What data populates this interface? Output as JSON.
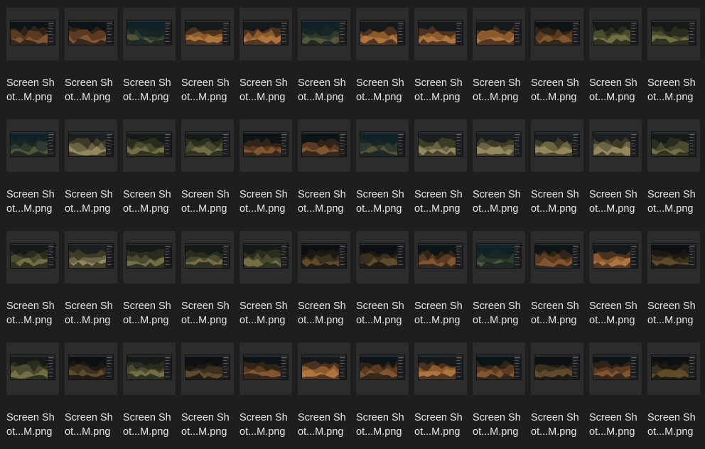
{
  "colors": {
    "background": "#1e1e1e",
    "thumbnail_frame": "#2c2c2c",
    "label_text": "#e6e6e6"
  },
  "files": [
    {
      "name_line1": "Screen Sh",
      "name_line2": "ot...M.png",
      "tone": "dark-orange"
    },
    {
      "name_line1": "Screen Sh",
      "name_line2": "ot...M.png",
      "tone": "dark-orange"
    },
    {
      "name_line1": "Screen Sh",
      "name_line2": "ot...M.png",
      "tone": "teal"
    },
    {
      "name_line1": "Screen Sh",
      "name_line2": "ot...M.png",
      "tone": "orange"
    },
    {
      "name_line1": "Screen Sh",
      "name_line2": "ot...M.png",
      "tone": "orange"
    },
    {
      "name_line1": "Screen Sh",
      "name_line2": "ot...M.png",
      "tone": "teal"
    },
    {
      "name_line1": "Screen Sh",
      "name_line2": "ot...M.png",
      "tone": "orange"
    },
    {
      "name_line1": "Screen Sh",
      "name_line2": "ot...M.png",
      "tone": "orange"
    },
    {
      "name_line1": "Screen Sh",
      "name_line2": "ot...M.png",
      "tone": "orange"
    },
    {
      "name_line1": "Screen Sh",
      "name_line2": "ot...M.png",
      "tone": "dark-orange"
    },
    {
      "name_line1": "Screen Sh",
      "name_line2": "ot...M.png",
      "tone": "olive"
    },
    {
      "name_line1": "Screen Sh",
      "name_line2": "ot...M.png",
      "tone": "olive"
    },
    {
      "name_line1": "Screen Sh",
      "name_line2": "ot...M.png",
      "tone": "teal"
    },
    {
      "name_line1": "Screen Sh",
      "name_line2": "ot...M.png",
      "tone": "sand"
    },
    {
      "name_line1": "Screen Sh",
      "name_line2": "ot...M.png",
      "tone": "olive"
    },
    {
      "name_line1": "Screen Sh",
      "name_line2": "ot...M.png",
      "tone": "olive"
    },
    {
      "name_line1": "Screen Sh",
      "name_line2": "ot...M.png",
      "tone": "dark-orange"
    },
    {
      "name_line1": "Screen Sh",
      "name_line2": "ot...M.png",
      "tone": "dark-orange"
    },
    {
      "name_line1": "Screen Sh",
      "name_line2": "ot...M.png",
      "tone": "teal"
    },
    {
      "name_line1": "Screen Sh",
      "name_line2": "ot...M.png",
      "tone": "sand"
    },
    {
      "name_line1": "Screen Sh",
      "name_line2": "ot...M.png",
      "tone": "sand"
    },
    {
      "name_line1": "Screen Sh",
      "name_line2": "ot...M.png",
      "tone": "sand"
    },
    {
      "name_line1": "Screen Sh",
      "name_line2": "ot...M.png",
      "tone": "sand"
    },
    {
      "name_line1": "Screen Sh",
      "name_line2": "ot...M.png",
      "tone": "olive"
    },
    {
      "name_line1": "Screen Sh",
      "name_line2": "ot...M.png",
      "tone": "olive"
    },
    {
      "name_line1": "Screen Sh",
      "name_line2": "ot...M.png",
      "tone": "sand"
    },
    {
      "name_line1": "Screen Sh",
      "name_line2": "ot...M.png",
      "tone": "olive"
    },
    {
      "name_line1": "Screen Sh",
      "name_line2": "ot...M.png",
      "tone": "olive"
    },
    {
      "name_line1": "Screen Sh",
      "name_line2": "ot...M.png",
      "tone": "olive"
    },
    {
      "name_line1": "Screen Sh",
      "name_line2": "ot...M.png",
      "tone": "dark"
    },
    {
      "name_line1": "Screen Sh",
      "name_line2": "ot...M.png",
      "tone": "dark"
    },
    {
      "name_line1": "Screen Sh",
      "name_line2": "ot...M.png",
      "tone": "dark-orange"
    },
    {
      "name_line1": "Screen Sh",
      "name_line2": "ot...M.png",
      "tone": "teal"
    },
    {
      "name_line1": "Screen Sh",
      "name_line2": "ot...M.png",
      "tone": "dark-orange"
    },
    {
      "name_line1": "Screen Sh",
      "name_line2": "ot...M.png",
      "tone": "orange"
    },
    {
      "name_line1": "Screen Sh",
      "name_line2": "ot...M.png",
      "tone": "dark"
    },
    {
      "name_line1": "Screen Sh",
      "name_line2": "ot...M.png",
      "tone": "olive"
    },
    {
      "name_line1": "Screen Sh",
      "name_line2": "ot...M.png",
      "tone": "dark"
    },
    {
      "name_line1": "Screen Sh",
      "name_line2": "ot...M.png",
      "tone": "olive"
    },
    {
      "name_line1": "Screen Sh",
      "name_line2": "ot...M.png",
      "tone": "dark"
    },
    {
      "name_line1": "Screen Sh",
      "name_line2": "ot...M.png",
      "tone": "dark-orange"
    },
    {
      "name_line1": "Screen Sh",
      "name_line2": "ot...M.png",
      "tone": "orange"
    },
    {
      "name_line1": "Screen Sh",
      "name_line2": "ot...M.png",
      "tone": "dark-orange"
    },
    {
      "name_line1": "Screen Sh",
      "name_line2": "ot...M.png",
      "tone": "orange"
    },
    {
      "name_line1": "Screen Sh",
      "name_line2": "ot...M.png",
      "tone": "dark-orange"
    },
    {
      "name_line1": "Screen Sh",
      "name_line2": "ot...M.png",
      "tone": "dark"
    },
    {
      "name_line1": "Screen Sh",
      "name_line2": "ot...M.png",
      "tone": "dark-orange"
    },
    {
      "name_line1": "Screen Sh",
      "name_line2": "ot...M.png",
      "tone": "dark"
    }
  ],
  "tones": {
    "dark-orange": {
      "sky": "#0d1418",
      "a": "#5a3b22",
      "b": "#8a5a32",
      "c": "#2e2418"
    },
    "orange": {
      "sky": "#141a1c",
      "a": "#8b5a2e",
      "b": "#b67a40",
      "c": "#4a3220"
    },
    "teal": {
      "sky": "#0f2228",
      "a": "#2d3a30",
      "b": "#5e5a3a",
      "c": "#1a2624"
    },
    "olive": {
      "sky": "#141a18",
      "a": "#4a4a30",
      "b": "#7a7448",
      "c": "#2a2c1e"
    },
    "sand": {
      "sky": "#1a2020",
      "a": "#6a6444",
      "b": "#9a8e60",
      "c": "#3e3a28"
    },
    "dark": {
      "sky": "#0c1012",
      "a": "#3a3020",
      "b": "#66502e",
      "c": "#1c1812"
    }
  }
}
